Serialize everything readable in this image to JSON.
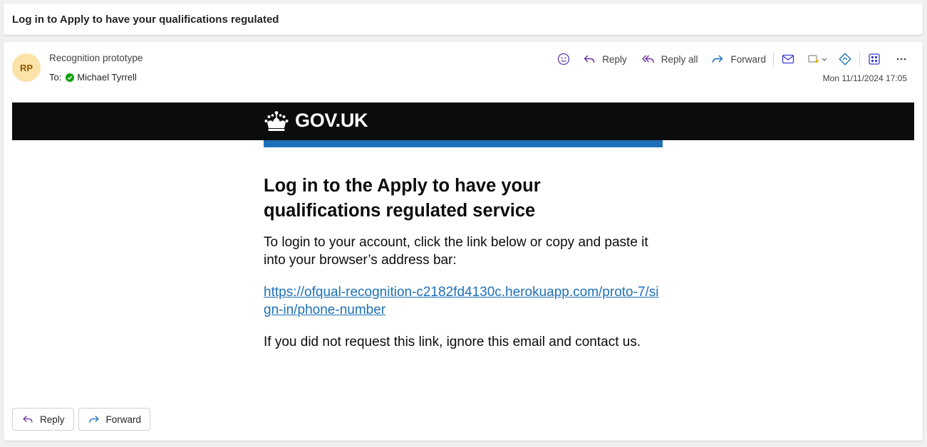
{
  "subject": "Log in to Apply to have your qualifications regulated",
  "message": {
    "avatar_initials": "RP",
    "sender": "Recognition prototype",
    "to_label": "To:",
    "recipient": "Michael Tyrrell",
    "date": "Mon 11/11/2024 17:05"
  },
  "toolbar": {
    "reply": "Reply",
    "reply_all": "Reply all",
    "forward": "Forward"
  },
  "email": {
    "logo_text": "GOV.UK",
    "heading": "Log in to the Apply to have your qualifications regulated service",
    "intro": "To login to your account, click the link below or copy and paste it into your browser’s address bar:",
    "link": "https://ofqual-recognition-c2182fd4130c.herokuapp.com/proto-7/sign-in/phone-number",
    "footer": "If you did not request this link, ignore this email and contact us."
  },
  "bottom": {
    "reply": "Reply",
    "forward": "Forward"
  },
  "colors": {
    "accent": "#6b2fa0",
    "gov_black": "#0b0c0c",
    "gov_blue": "#1d70b8",
    "status_green": "#13a10e"
  }
}
